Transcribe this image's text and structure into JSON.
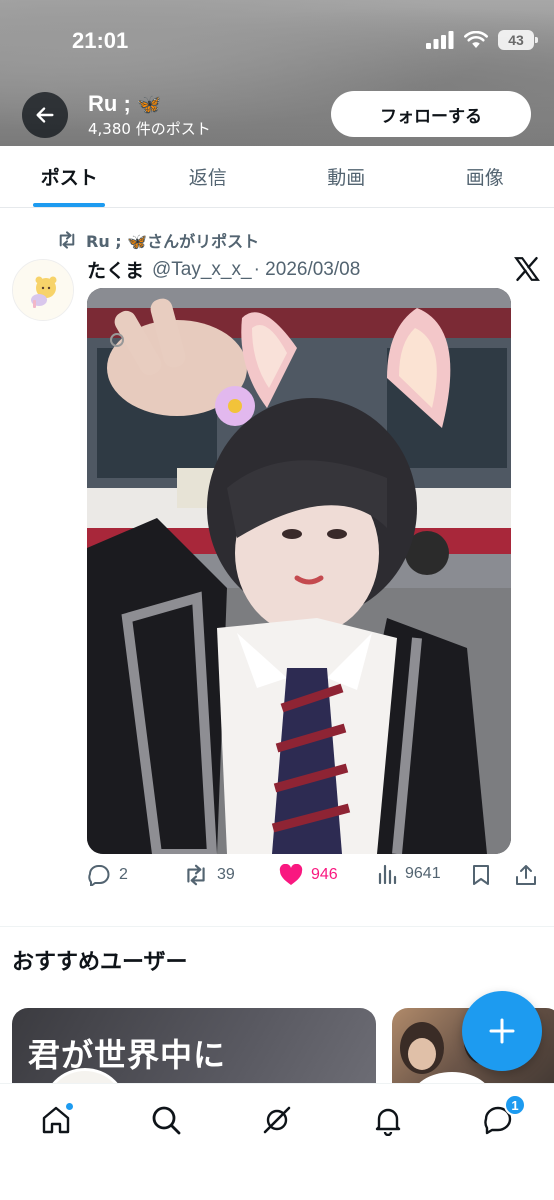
{
  "status_bar": {
    "time": "21:01",
    "battery": "43"
  },
  "header": {
    "name": "Ru ;",
    "name_emoji": "🦋",
    "post_count": "4,380 件のポスト",
    "follow_label": "フォローする"
  },
  "tabs": [
    {
      "label": "ポスト",
      "active": true
    },
    {
      "label": "返信",
      "active": false
    },
    {
      "label": "動画",
      "active": false
    },
    {
      "label": "画像",
      "active": false
    }
  ],
  "post": {
    "repost_by": "Ru ; 🦋さんがリポスト",
    "author": "たくま",
    "handle": "@Tay_x_x_",
    "date": "· 2026/03/08",
    "replies": "2",
    "reposts": "39",
    "likes": "946",
    "views": "9641"
  },
  "recommended": {
    "title": "おすすめユーザー",
    "card1_text": "君が世界中に"
  },
  "bottom_nav": {
    "messages_badge": "1"
  },
  "colors": {
    "accent": "#1d9bf0",
    "like": "#f91880",
    "muted": "#536471",
    "text": "#0f1419"
  }
}
